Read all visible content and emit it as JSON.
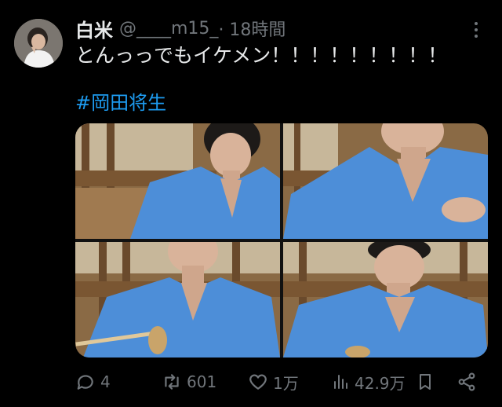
{
  "tweet": {
    "display_name": "白米",
    "handle": "@____m15_",
    "time": "· 18時間",
    "text": "とんっっでもイケメン！！！！！！！！！",
    "hashtag": "#岡田将生"
  },
  "actions": {
    "replies": "4",
    "retweets": "601",
    "likes": "1万",
    "views": "42.9万"
  },
  "icons": {
    "more": "more-dots-icon",
    "reply": "speech-bubble-icon",
    "retweet": "retweet-arrows-icon",
    "like": "heart-icon",
    "views": "bar-chart-icon",
    "bookmark": "bookmark-icon",
    "share": "share-icon"
  },
  "colors": {
    "background": "#000000",
    "text": "#e7e9ea",
    "muted": "#71767b",
    "hashtag": "#1d9bf0",
    "shirt": "#4d8ed8"
  }
}
